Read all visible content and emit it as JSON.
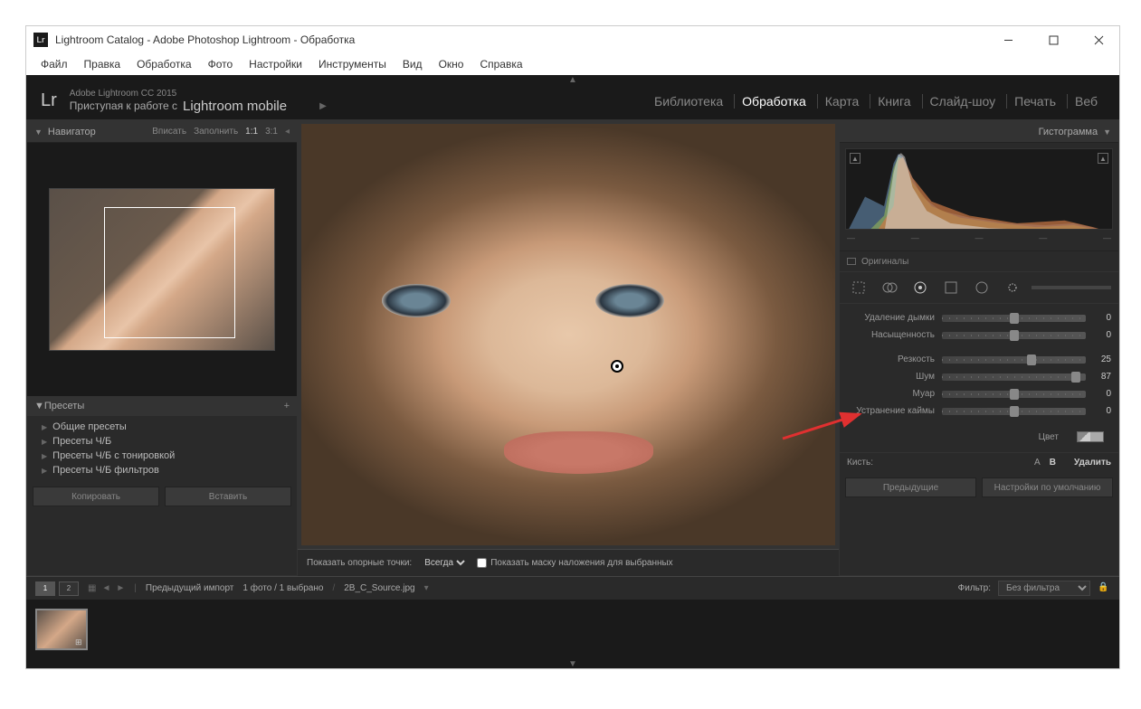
{
  "titlebar": "Lightroom Catalog - Adobe Photoshop Lightroom - Обработка",
  "menu": [
    "Файл",
    "Правка",
    "Обработка",
    "Фото",
    "Настройки",
    "Инструменты",
    "Вид",
    "Окно",
    "Справка"
  ],
  "brand": {
    "logo": "Lr",
    "version": "Adobe Lightroom CC 2015",
    "sub_prefix": "Приступая к работе с",
    "sub_mobile": "Lightroom mobile"
  },
  "modules": [
    {
      "label": "Библиотека",
      "active": false
    },
    {
      "label": "Обработка",
      "active": true
    },
    {
      "label": "Карта",
      "active": false
    },
    {
      "label": "Книга",
      "active": false
    },
    {
      "label": "Слайд-шоу",
      "active": false
    },
    {
      "label": "Печать",
      "active": false
    },
    {
      "label": "Веб",
      "active": false
    }
  ],
  "navigator": {
    "title": "Навигатор",
    "opts": [
      "Вписать",
      "Заполнить",
      "1:1",
      "3:1"
    ]
  },
  "presets": {
    "title": "Пресеты",
    "items": [
      "Общие пресеты",
      "Пресеты Ч/Б",
      "Пресеты Ч/Б с тонировкой",
      "Пресеты Ч/Б фильтров"
    ]
  },
  "left_buttons": {
    "copy": "Копировать",
    "paste": "Вставить"
  },
  "center_toolbar": {
    "anchor_label": "Показать опорные точки:",
    "anchor_value": "Всегда",
    "mask_label": "Показать маску наложения для выбранных"
  },
  "histogram": {
    "title": "Гистограмма",
    "vals": [
      "—",
      "—",
      "—",
      "—",
      "—"
    ]
  },
  "originals": "Оригиналы",
  "sliders": [
    {
      "label": "Удаление дымки",
      "val": 0,
      "pos": 50
    },
    {
      "label": "Насыщенность",
      "val": 0,
      "pos": 50
    },
    {
      "label": "Резкость",
      "val": 25,
      "pos": 62
    },
    {
      "label": "Шум",
      "val": 87,
      "pos": 93,
      "highlight": true
    },
    {
      "label": "Муар",
      "val": 0,
      "pos": 50
    },
    {
      "label": "Устранение каймы",
      "val": 0,
      "pos": 50
    }
  ],
  "color_label": "Цвет",
  "brush": {
    "label": "Кисть:",
    "a": "A",
    "b": "B",
    "del": "Удалить"
  },
  "right_buttons": {
    "prev": "Предыдущие",
    "reset": "Настройки по умолчанию"
  },
  "filmstrip_bar": {
    "views": [
      "1",
      "2"
    ],
    "source": "Предыдущий импорт",
    "count": "1 фото / 1 выбрано",
    "filename": "2B_C_Source.jpg",
    "filter_label": "Фильтр:",
    "filter_value": "Без фильтра"
  }
}
